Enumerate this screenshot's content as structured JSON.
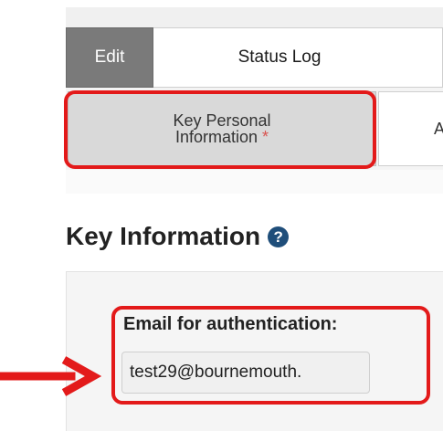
{
  "tabs": {
    "edit_label": "Edit",
    "status_log_label": "Status Log"
  },
  "subtabs": {
    "key_personal_line1": "Key Personal",
    "key_personal_line2": "Information",
    "required_marker": "*",
    "next_partial": "A"
  },
  "section": {
    "title": "Key Information",
    "help_glyph": "?"
  },
  "field": {
    "label": "Email for authentication:",
    "value": "test29@bournemouth."
  },
  "colors": {
    "highlight": "#e31a1a",
    "active_tab": "#7a7a7a",
    "help_icon": "#1f4e7a",
    "required": "#d9534f"
  }
}
